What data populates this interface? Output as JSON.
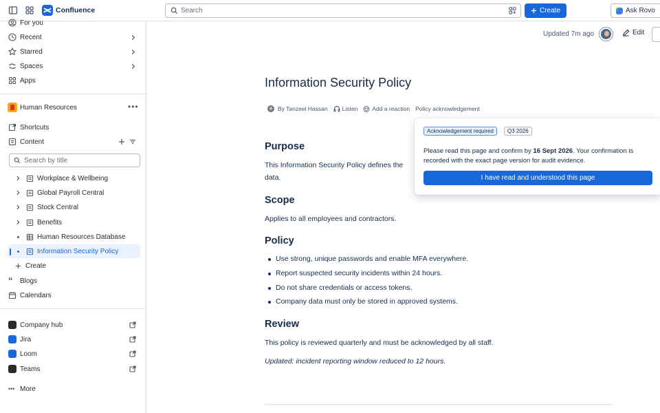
{
  "topbar": {
    "app_name": "Confluence",
    "search_placeholder": "Search",
    "create_label": "Create",
    "ask_rovo_label": "Ask Rovo"
  },
  "sidebar": {
    "nav": [
      {
        "label": "For you",
        "icon": "person-icon"
      },
      {
        "label": "Recent",
        "icon": "clock-icon"
      },
      {
        "label": "Starred",
        "icon": "star-icon"
      },
      {
        "label": "Spaces",
        "icon": "spaces-icon"
      },
      {
        "label": "Apps",
        "icon": "apps-icon"
      }
    ],
    "space_name": "Human Resources",
    "shortcuts_label": "Shortcuts",
    "content_label": "Content",
    "search_placeholder": "Search by title",
    "tree": [
      {
        "label": "Workplace & Wellbeing",
        "has_children": true
      },
      {
        "label": "Global Payroll Central",
        "has_children": true
      },
      {
        "label": "Stock Central",
        "has_children": true
      },
      {
        "label": "Benefits",
        "has_children": true
      },
      {
        "label": "Human Resources Database",
        "has_children": false
      },
      {
        "label": "Information Security Policy",
        "has_children": false,
        "active": true
      }
    ],
    "create_label": "Create",
    "blogs_label": "Blogs",
    "calendars_label": "Calendars",
    "apps": [
      {
        "label": "Company hub",
        "icon": "company-hub-icon",
        "color": "#292a2e"
      },
      {
        "label": "Jira",
        "icon": "jira-icon",
        "color": "#1868db"
      },
      {
        "label": "Loom",
        "icon": "loom-icon",
        "color": "#1868db"
      },
      {
        "label": "Teams",
        "icon": "teams-icon",
        "color": "#292a2e"
      }
    ],
    "more_label": "More"
  },
  "page": {
    "updated": "Updated 7m ago",
    "edit_label": "Edit",
    "title": "Information Security Policy",
    "byline": {
      "author": "By Tanzeel Hassan",
      "listen": "Listen",
      "reaction": "Add a reaction",
      "acknowledgement": "Policy acknowledgement"
    },
    "purpose_heading": "Purpose",
    "purpose_text_1": "This Information Security Policy defines the",
    "purpose_text_2": "data.",
    "scope_heading": "Scope",
    "scope_text": "Applies to all employees and contractors.",
    "policy_heading": "Policy",
    "policy_items": [
      "Use strong, unique passwords and enable MFA everywhere.",
      "Report suspected security incidents within 24 hours.",
      "Do not share credentials or access tokens.",
      "Company data must only be stored in approved systems."
    ],
    "review_heading": "Review",
    "review_text": "This policy is reviewed quarterly and must be acknowledged by all staff.",
    "updated_note": "Updated: incident reporting window reduced to 12 hours."
  },
  "popup": {
    "badge_required": "Acknowledgement required",
    "badge_quarter": "Q3 2026",
    "text_before": "Please read this page and confirm by ",
    "deadline": "16 Sept 2026",
    "text_after": ". Your confirmation is recorded with the exact page version for audit evidence.",
    "button_label": "I have read and understood this page"
  },
  "colors": {
    "accent": "#1868db",
    "text": "#172b4d",
    "border": "#dcdfe4"
  }
}
